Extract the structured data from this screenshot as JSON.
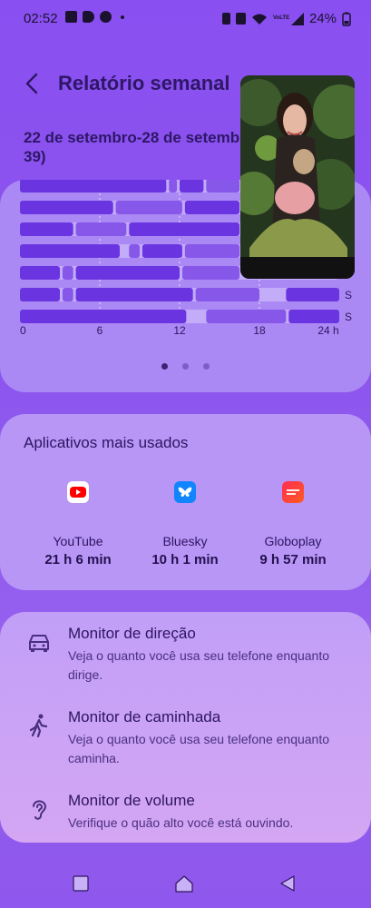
{
  "status_bar": {
    "time": "02:52",
    "battery": "24%",
    "network_label": "VoLTE"
  },
  "header": {
    "title": "Relatório semanal",
    "back_icon": "chevron-left-icon"
  },
  "date_range": {
    "line1": "22 de setembro-28 de setemb",
    "line2": "39)"
  },
  "chart_data": {
    "type": "timeline",
    "x_ticks": [
      "0",
      "6",
      "12",
      "18",
      "24 h"
    ],
    "xlim": [
      0,
      24
    ],
    "row_labels": [
      "",
      "",
      "",
      "",
      "",
      "S",
      "S"
    ],
    "rows": [
      [
        [
          0,
          11
        ],
        [
          11.2,
          11.8
        ],
        [
          12,
          13.8
        ],
        [
          14,
          16.5
        ]
      ],
      [
        [
          0,
          7
        ],
        [
          7.2,
          12.2
        ],
        [
          12.4,
          16.5
        ]
      ],
      [
        [
          0,
          4
        ],
        [
          4.2,
          8
        ],
        [
          8.2,
          16.5
        ]
      ],
      [
        [
          0,
          7.5
        ],
        [
          8.2,
          9
        ],
        [
          9.2,
          12.2
        ],
        [
          12.4,
          16.5
        ]
      ],
      [
        [
          0,
          3
        ],
        [
          3.2,
          4
        ],
        [
          4.2,
          12
        ],
        [
          12.2,
          16.5
        ]
      ],
      [
        [
          0,
          3
        ],
        [
          3.2,
          4
        ],
        [
          4.2,
          13
        ],
        [
          13.2,
          18
        ],
        [
          20,
          24
        ]
      ],
      [
        [
          0,
          12.5
        ],
        [
          14,
          20
        ],
        [
          20.2,
          24
        ]
      ]
    ],
    "colors": {
      "usage": "#6a35e0",
      "light": "#8757ea",
      "track": "#c3acf8"
    },
    "page_dots": 3,
    "active_page": 0
  },
  "most_used": {
    "title": "Aplicativos mais usados",
    "apps": [
      {
        "name": "YouTube",
        "time": "21 h 6 min",
        "icon": "youtube-icon",
        "color": "#ff0000"
      },
      {
        "name": "Bluesky",
        "time": "10 h 1 min",
        "icon": "bluesky-icon",
        "color": "#1185fe"
      },
      {
        "name": "Globoplay",
        "time": "9 h 57 min",
        "icon": "globoplay-icon",
        "color": "#ff3c4b"
      }
    ]
  },
  "monitors": [
    {
      "title": "Monitor de direção",
      "desc": "Veja o quanto você usa seu telefone enquanto dirige.",
      "icon": "car-icon"
    },
    {
      "title": "Monitor de caminhada",
      "desc": "Veja o quanto você usa seu telefone enquanto caminha.",
      "icon": "walking-icon"
    },
    {
      "title": "Monitor de volume",
      "desc": "Verifique o quão alto você está ouvindo.",
      "icon": "ear-icon"
    }
  ],
  "nav": {
    "recents": "recents-icon",
    "home": "home-icon",
    "back": "back-icon"
  }
}
